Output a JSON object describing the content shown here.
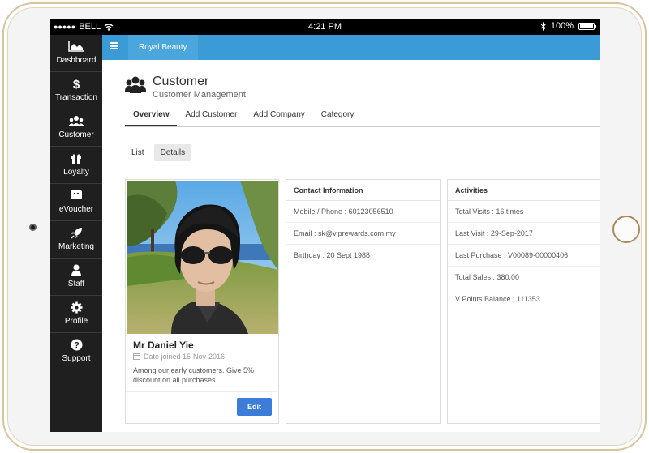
{
  "status_bar": {
    "carrier": "BELL",
    "time": "4:21 PM",
    "battery": "100%"
  },
  "sidebar": {
    "items": [
      {
        "label": "Dashboard",
        "icon": "chart-area-icon"
      },
      {
        "label": "Transaction",
        "icon": "dollar-icon"
      },
      {
        "label": "Customer",
        "icon": "users-icon"
      },
      {
        "label": "Loyalty",
        "icon": "gift-icon"
      },
      {
        "label": "eVoucher",
        "icon": "ticket-icon"
      },
      {
        "label": "Marketing",
        "icon": "rocket-icon"
      },
      {
        "label": "Staff",
        "icon": "user-icon"
      },
      {
        "label": "Profile",
        "icon": "gear-icon"
      },
      {
        "label": "Support",
        "icon": "question-icon"
      }
    ]
  },
  "topbar": {
    "brand": "Royal Beauty"
  },
  "page": {
    "title": "Customer",
    "subtitle": "Customer Management"
  },
  "tabs": [
    "Overview",
    "Add Customer",
    "Add Company",
    "Category"
  ],
  "subtabs": [
    "List",
    "Details"
  ],
  "profile": {
    "name": "Mr Daniel Yie",
    "date_joined": "Date joined 15-Nov-2016",
    "note": "Among our early customers. Give 5% discount on all purchases.",
    "edit_label": "Edit"
  },
  "contact": {
    "header": "Contact Information",
    "rows": [
      "Mobile / Phone : 60123056510",
      "Email : sk@viprewards.com.my",
      "Birthday : 20 Sept 1988"
    ]
  },
  "activities": {
    "header": "Activities",
    "rows": [
      "Total Visits : 16 times",
      "Last Visit : 29-Sep-2017",
      "Last Purchase : V00089-00000406",
      "Total Sales : 380.00",
      "V Points Balance : 111353"
    ]
  },
  "colors": {
    "topbar": "#3b9bd6",
    "sidebar": "#1f1f1f",
    "edit_button": "#3b7dd8",
    "frame_gold": "#d8c4a0"
  }
}
